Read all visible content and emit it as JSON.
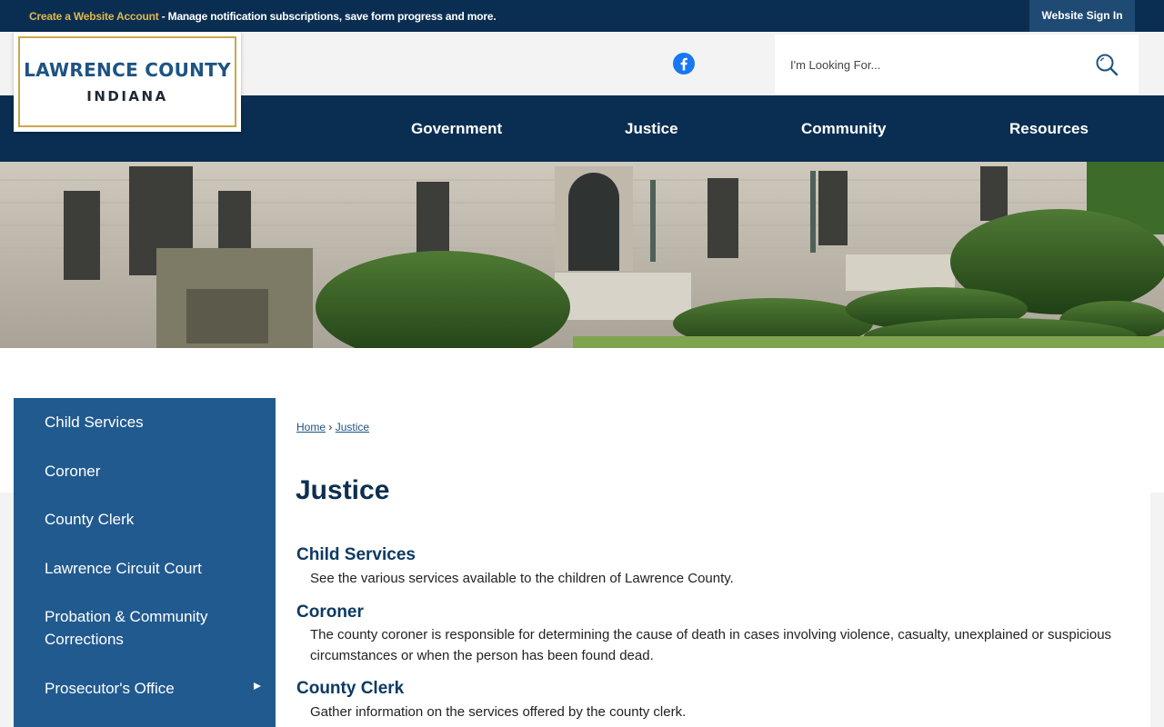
{
  "topbar": {
    "create_account": "Create a Website Account",
    "create_account_rest": " - Manage notification subscriptions, save form progress and more.",
    "sign_in": "Website Sign In"
  },
  "logo": {
    "line1": "LAWRENCE COUNTY",
    "line2": "INDIANA"
  },
  "search": {
    "placeholder": "I'm Looking For..."
  },
  "nav": {
    "items": [
      {
        "label": "Government"
      },
      {
        "label": "Justice"
      },
      {
        "label": "Community"
      },
      {
        "label": "Resources"
      }
    ]
  },
  "sidebar": {
    "items": [
      {
        "label": "Child Services"
      },
      {
        "label": "Coroner"
      },
      {
        "label": "County Clerk"
      },
      {
        "label": "Lawrence Circuit Court"
      },
      {
        "label": "Probation & Community Corrections"
      },
      {
        "label": "Prosecutor's Office"
      }
    ]
  },
  "breadcrumb": {
    "home": "Home",
    "separator": "›",
    "current": "Justice"
  },
  "page": {
    "title": "Justice",
    "sections": [
      {
        "heading": "Child Services",
        "text": "See the various services available to the children of Lawrence County."
      },
      {
        "heading": "Coroner",
        "text": "The county coroner is responsible for determining the cause of death in cases involving violence, casualty, unexplained or suspicious circumstances or when the person has been found dead."
      },
      {
        "heading": "County Clerk",
        "text": "Gather information on the services offered by the county clerk."
      }
    ]
  },
  "colors": {
    "navy": "#0a2e52",
    "sidebar_blue": "#215a8f",
    "gold": "#c9a84c",
    "heading_blue": "#0d3a63"
  },
  "icons": {
    "social": "facebook-icon",
    "search": "search-icon",
    "submenu": "triangle-right-icon"
  }
}
